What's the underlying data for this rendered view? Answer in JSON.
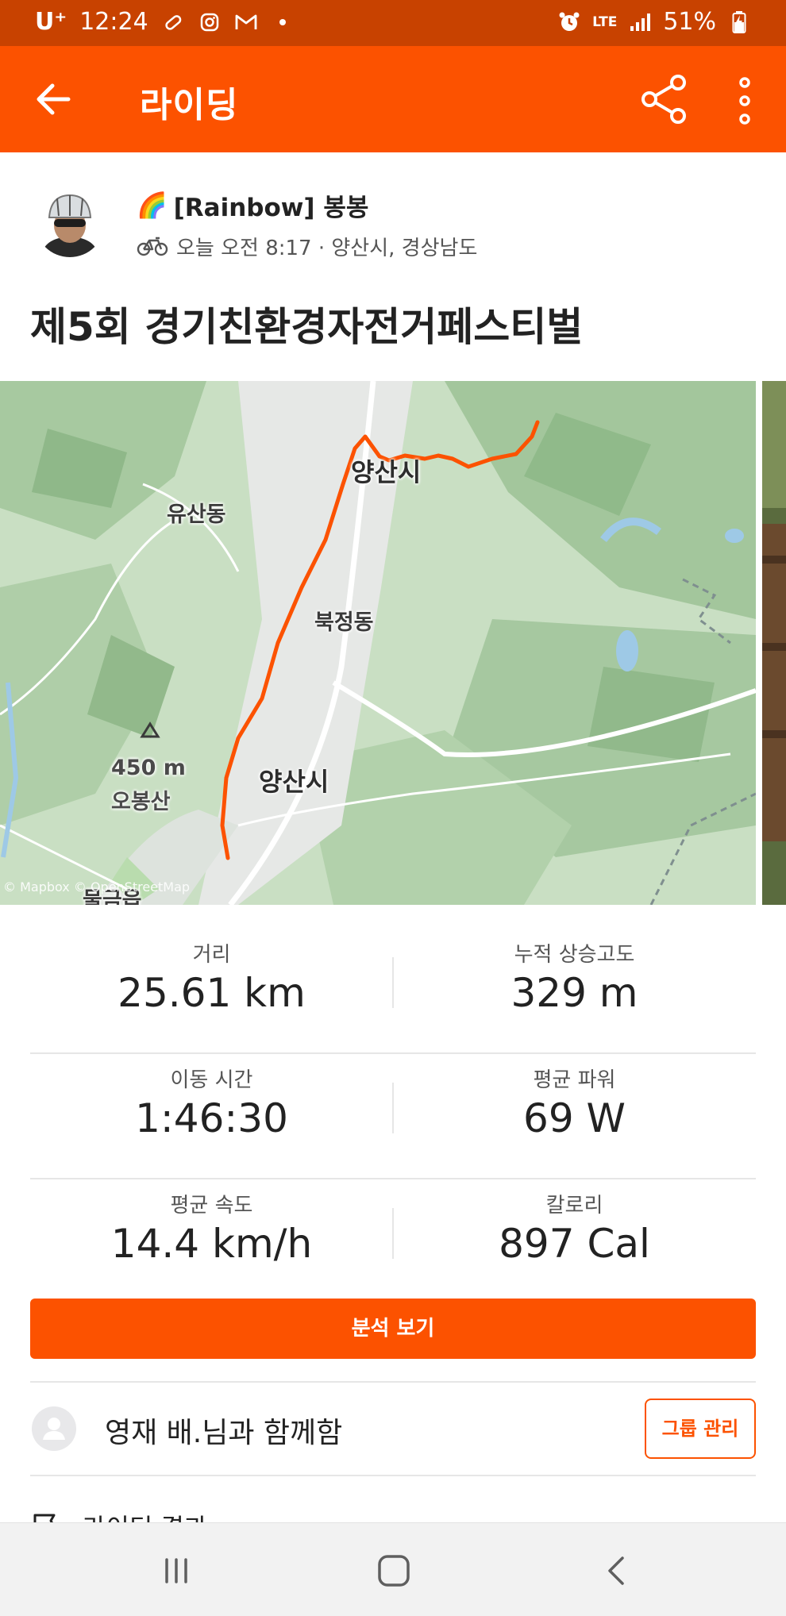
{
  "status_bar": {
    "carrier": "U⁺",
    "time": "12:24",
    "network": "LTE",
    "battery": "51%",
    "icons": [
      "pill-icon",
      "instagram-icon",
      "gmail-icon",
      "dot-icon",
      "alarm-icon",
      "signal-icon",
      "battery-charging-icon"
    ]
  },
  "app_bar": {
    "title": "라이딩",
    "back_icon": "arrow-left-icon",
    "share_icon": "share-icon",
    "more_icon": "more-vertical-icon"
  },
  "activity": {
    "athlete_emoji": "🌈",
    "athlete_name": "[Rainbow] 봉봉",
    "sport_icon": "bicycle-icon",
    "time_location": "오늘 오전 8:17 · 양산시, 경상남도",
    "title": "제5회 경기친환경자전거페스티벌"
  },
  "map": {
    "labels": {
      "yangsan_top": "양산시",
      "yusan": "유산동",
      "bukjeong": "북정동",
      "peak_height": "450 m",
      "peak_name": "오봉산",
      "yangsan_center": "양산시",
      "mulgeum": "물금읍"
    },
    "attribution": "© Mapbox © OpenStreetMap",
    "route_color": "#fc5200"
  },
  "stats": [
    {
      "label": "거리",
      "value": "25.61 km"
    },
    {
      "label": "누적 상승고도",
      "value": "329 m"
    },
    {
      "label": "이동 시간",
      "value": "1:46:30"
    },
    {
      "label": "평균 파워",
      "value": "69 W"
    },
    {
      "label": "평균 속도",
      "value": "14.4 km/h"
    },
    {
      "label": "칼로리",
      "value": "897 Cal"
    }
  ],
  "analyze_button": "분석 보기",
  "group": {
    "with_text": "영재 배.님과 함께함",
    "manage_button": "그룹 관리"
  },
  "next_row": {
    "icon": "flag-icon",
    "text": "라이딩 결과"
  },
  "nav_bar": {
    "recents_icon": "recents-icon",
    "home_icon": "home-icon",
    "back_icon": "back-chevron-icon"
  },
  "colors": {
    "brand": "#fc5200",
    "status_bar": "#c84200"
  }
}
